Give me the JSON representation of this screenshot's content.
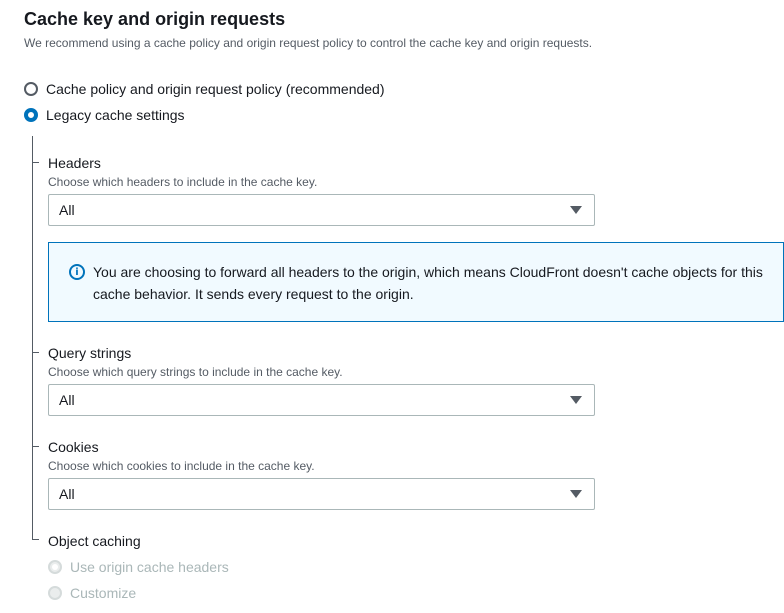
{
  "section": {
    "title": "Cache key and origin requests",
    "description": "We recommend using a cache policy and origin request policy to control the cache key and origin requests."
  },
  "options": [
    {
      "label": "Cache policy and origin request policy (recommended)",
      "selected": false
    },
    {
      "label": "Legacy cache settings",
      "selected": true
    }
  ],
  "headers": {
    "label": "Headers",
    "description": "Choose which headers to include in the cache key.",
    "value": "All"
  },
  "info": {
    "icon": "info-icon",
    "text": "You are choosing to forward all headers to the origin, which means CloudFront doesn't cache objects for this cache behavior. It sends every request to the origin."
  },
  "query_strings": {
    "label": "Query strings",
    "description": "Choose which query strings to include in the cache key.",
    "value": "All"
  },
  "cookies": {
    "label": "Cookies",
    "description": "Choose which cookies to include in the cache key.",
    "value": "All"
  },
  "object_caching": {
    "label": "Object caching",
    "options": [
      {
        "label": "Use origin cache headers",
        "selected": true,
        "disabled": true
      },
      {
        "label": "Customize",
        "selected": false,
        "disabled": true
      }
    ]
  },
  "colors": {
    "accent": "#0073bb",
    "info_background": "#f1faff",
    "disabled_text": "#aab7b8"
  }
}
